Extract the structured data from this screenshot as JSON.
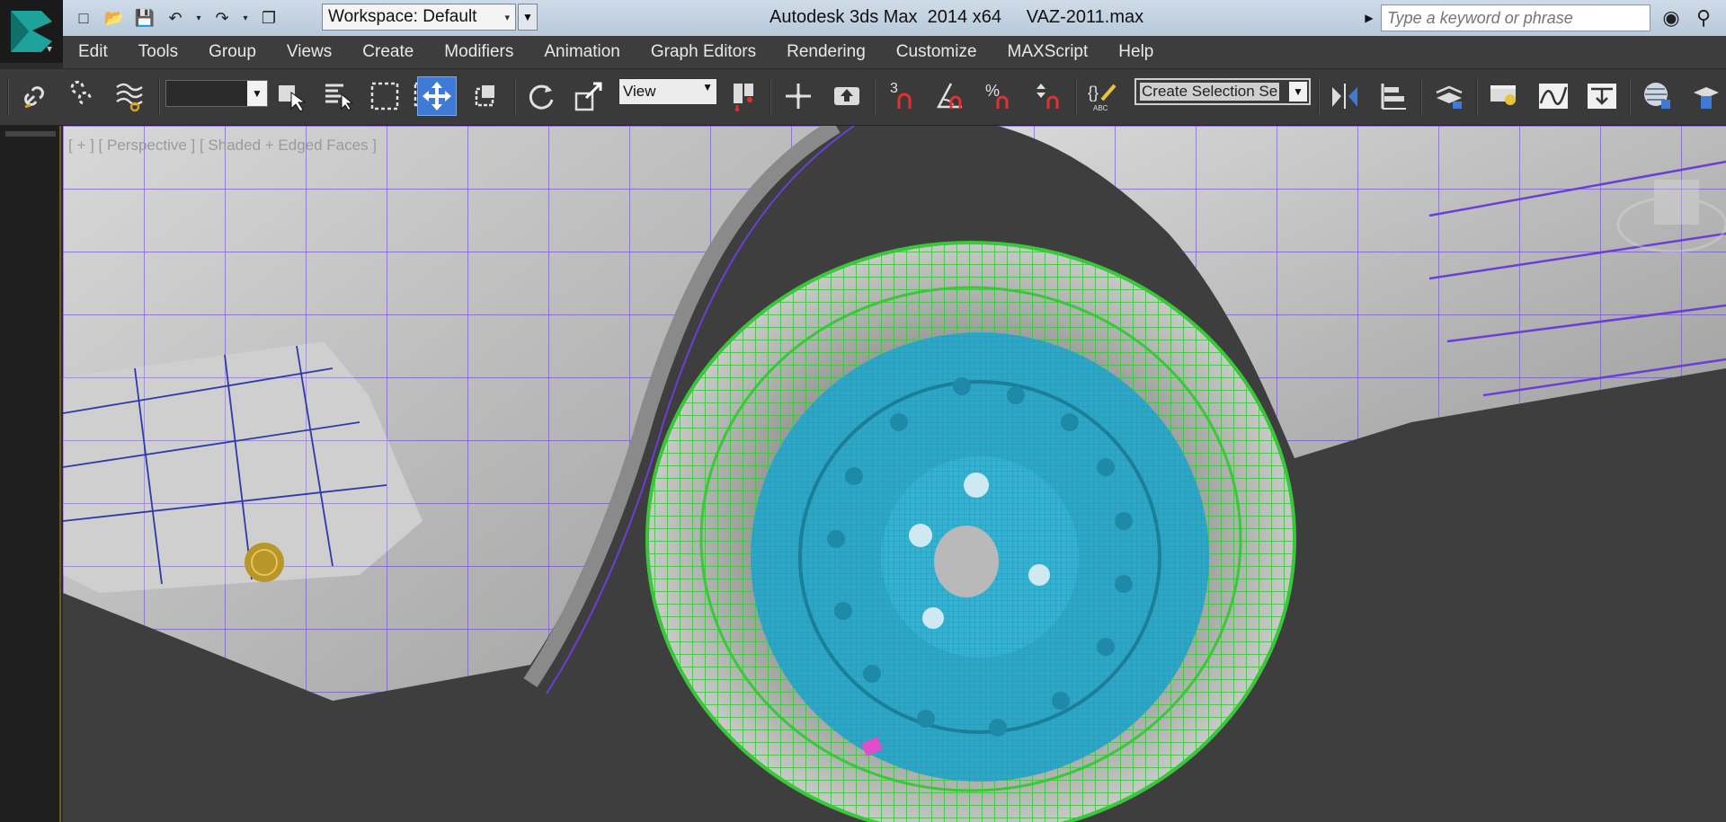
{
  "window": {
    "title": "Autodesk 3ds Max  2014 x64     VAZ-2011.max",
    "workspace": "Workspace: Default",
    "search_placeholder": "Type a keyword or phrase"
  },
  "menus": [
    "Edit",
    "Tools",
    "Group",
    "Views",
    "Create",
    "Modifiers",
    "Animation",
    "Graph Editors",
    "Rendering",
    "Customize",
    "MAXScript",
    "Help"
  ],
  "toolbar": {
    "reference_coordinate_system": "View",
    "named_selection_set": "Create Selection Se",
    "snap_label": "3",
    "angle_snap_label": "",
    "percent_snap_label": "%",
    "select_and_move_active": true
  },
  "viewport": {
    "label": "[ + ] [ Perspective ] [ Shaded + Edged Faces ]"
  },
  "colors": {
    "tire_wire": "#39c83a",
    "rim": "#29a8c8",
    "body_wire": "#6b3fd6",
    "active_tool": "#3f7ad4"
  }
}
